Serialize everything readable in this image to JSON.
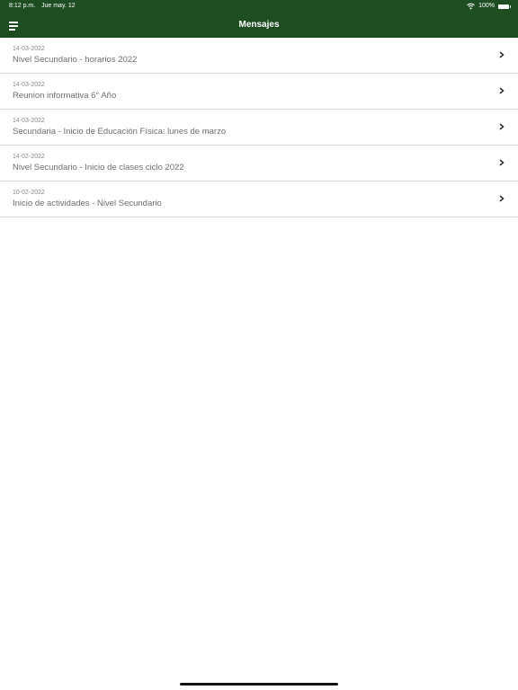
{
  "status_bar": {
    "time": "8:12 p.m.",
    "date": "Jue may. 12",
    "battery": "100%",
    "battery_level": 1.0
  },
  "nav": {
    "title": "Mensajes",
    "menu_icon": "hamburger-menu-icon"
  },
  "colors": {
    "header_bg": "#1f4d22",
    "header_text": "#ffffff",
    "date_text": "#8a8a8a",
    "subject_text": "#6e6e6e",
    "divider": "#d9d9d9"
  },
  "messages": [
    {
      "date": "14-03-2022",
      "subject": "Nivel Secundario - horarios 2022"
    },
    {
      "date": "14-03-2022",
      "subject": "Reunion informativa 6° Año"
    },
    {
      "date": "14-03-2022",
      "subject": "Secundaria - Inicio de Educación Física: lunes de marzo"
    },
    {
      "date": "14-02-2022",
      "subject": "Nivel Secundario - Inicio de clases ciclo 2022"
    },
    {
      "date": "10-02-2022",
      "subject": "Inicio de actividades - Nivel Secundario"
    }
  ]
}
